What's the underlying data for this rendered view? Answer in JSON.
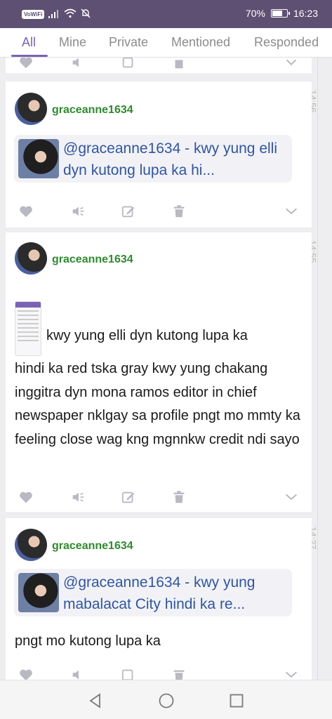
{
  "status_bar": {
    "wifi_label": "VoWiFi",
    "battery": "70%",
    "time": "16:23",
    "battery_level": 0.7
  },
  "tabs": [
    {
      "label": "All",
      "active": true
    },
    {
      "label": "Mine"
    },
    {
      "label": "Private"
    },
    {
      "label": "Mentioned"
    },
    {
      "label": "Responded"
    }
  ],
  "posts": [
    {
      "time": "14:56",
      "username": "graceanne1634",
      "quote": "@graceanne1634 - kwy yung elli dyn kutong lupa ka hi..."
    },
    {
      "time": "14:55",
      "username": "graceanne1634",
      "first_line": "kwy yung elli dyn kutong lupa ka",
      "body": "hindi ka red tska gray kwy yung chakang inggitra dyn mona ramos editor in chief newspaper nklgay sa profile pngt mo mmty ka feeling close wag kng mgnnkw credit ndi sayo"
    },
    {
      "time": "14:27",
      "username": "graceanne1634",
      "quote": "@graceanne1634 - kwy yung mabalacat City hindi ka re...",
      "body": "pngt mo kutong lupa ka"
    }
  ]
}
